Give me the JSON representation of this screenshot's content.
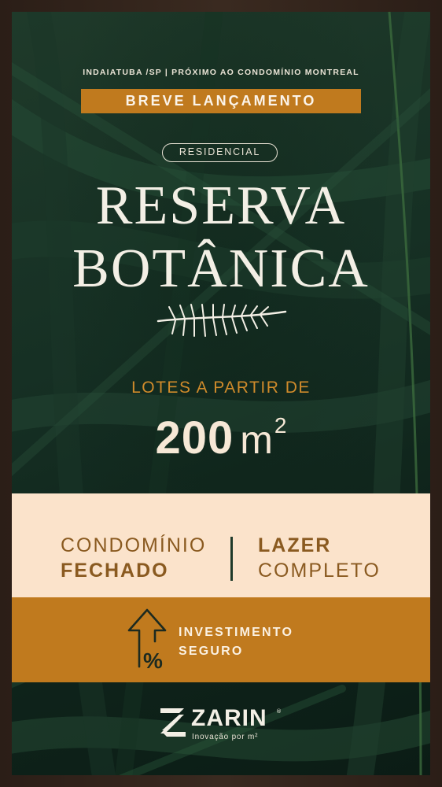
{
  "location_line": "INDAIATUBA /SP | PRÓXIMO AO CONDOMÍNIO MONTREAL",
  "badge": "BREVE LANÇAMENTO",
  "tag": "RESIDENCIAL",
  "title_line1": "RESERVA",
  "title_line2": "BOTÂNICA",
  "lots_intro": "LOTES A PARTIR DE",
  "lots_size": "200",
  "lots_unit": "m",
  "lots_unit_sup": "2",
  "feature_left": {
    "line1": "CONDOMÍNIO",
    "line2": "FECHADO"
  },
  "feature_right": {
    "line1": "LAZER",
    "line2": "COMPLETO"
  },
  "investment": {
    "line1": "INVESTIMENTO",
    "line2": "SEGURO",
    "icon": "arrow-up-percent-icon"
  },
  "brand": {
    "name": "ZARIN",
    "registered": "®",
    "tagline": "Inovação por m²"
  },
  "colors": {
    "accent": "#c07a1e",
    "cream": "#fbe3cb",
    "green": "#163024",
    "text_light": "#f3efe5"
  }
}
